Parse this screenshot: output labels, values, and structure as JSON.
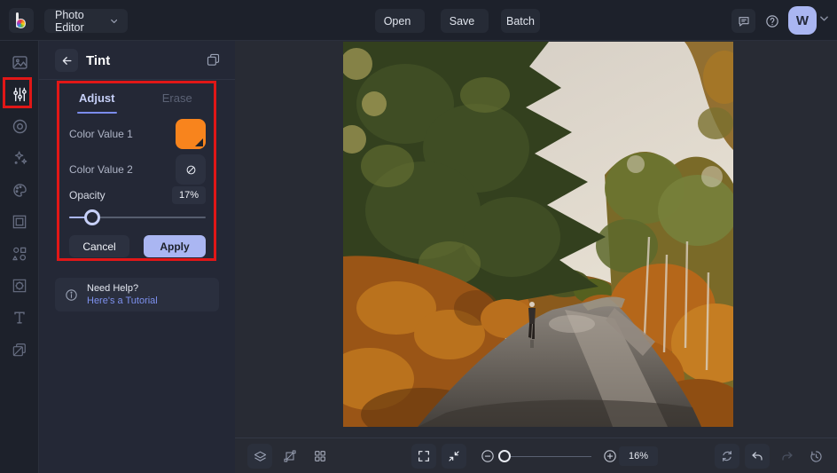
{
  "topbar": {
    "app_menu_label": "Photo Editor",
    "open_label": "Open",
    "save_label": "Save",
    "batch_label": "Batch",
    "avatar_initial": "W",
    "avatar_color": "#aab6f2"
  },
  "sidebar": {
    "items": [
      {
        "icon": "edit-photo-icon",
        "active": false
      },
      {
        "icon": "adjust-sliders-icon",
        "active": true,
        "annotated": true
      },
      {
        "icon": "touchup-eye-icon",
        "active": false
      },
      {
        "icon": "effects-sparkles-icon",
        "active": false
      },
      {
        "icon": "artsy-palette-icon",
        "active": false
      },
      {
        "icon": "frames-icon",
        "active": false
      },
      {
        "icon": "graphics-shapes-icon",
        "active": false
      },
      {
        "icon": "overlays-icon",
        "active": false
      },
      {
        "icon": "text-icon",
        "active": false
      },
      {
        "icon": "textures-icon",
        "active": false
      }
    ]
  },
  "panel": {
    "title": "Tint",
    "tabs": [
      {
        "label": "Adjust",
        "active": true
      },
      {
        "label": "Erase",
        "active": false
      }
    ],
    "color_value_1": {
      "label": "Color Value 1",
      "swatch_color": "#f8841d"
    },
    "color_value_2": {
      "label": "Color Value 2",
      "value": "none"
    },
    "opacity": {
      "label": "Opacity",
      "value": "17%",
      "percent": 17
    },
    "cancel_label": "Cancel",
    "apply_label": "Apply",
    "help": {
      "heading": "Need Help?",
      "link_label": "Here's a Tutorial"
    }
  },
  "canvas": {
    "image_description": "Person walking along a wet curving road lined with autumn trees, large dark pine at upper left, pale sky"
  },
  "bottom_toolbar": {
    "zoom_value": "16%",
    "zoom_slider_position_percent": 6
  },
  "annotations": {
    "highlight_color": "#e11717"
  }
}
